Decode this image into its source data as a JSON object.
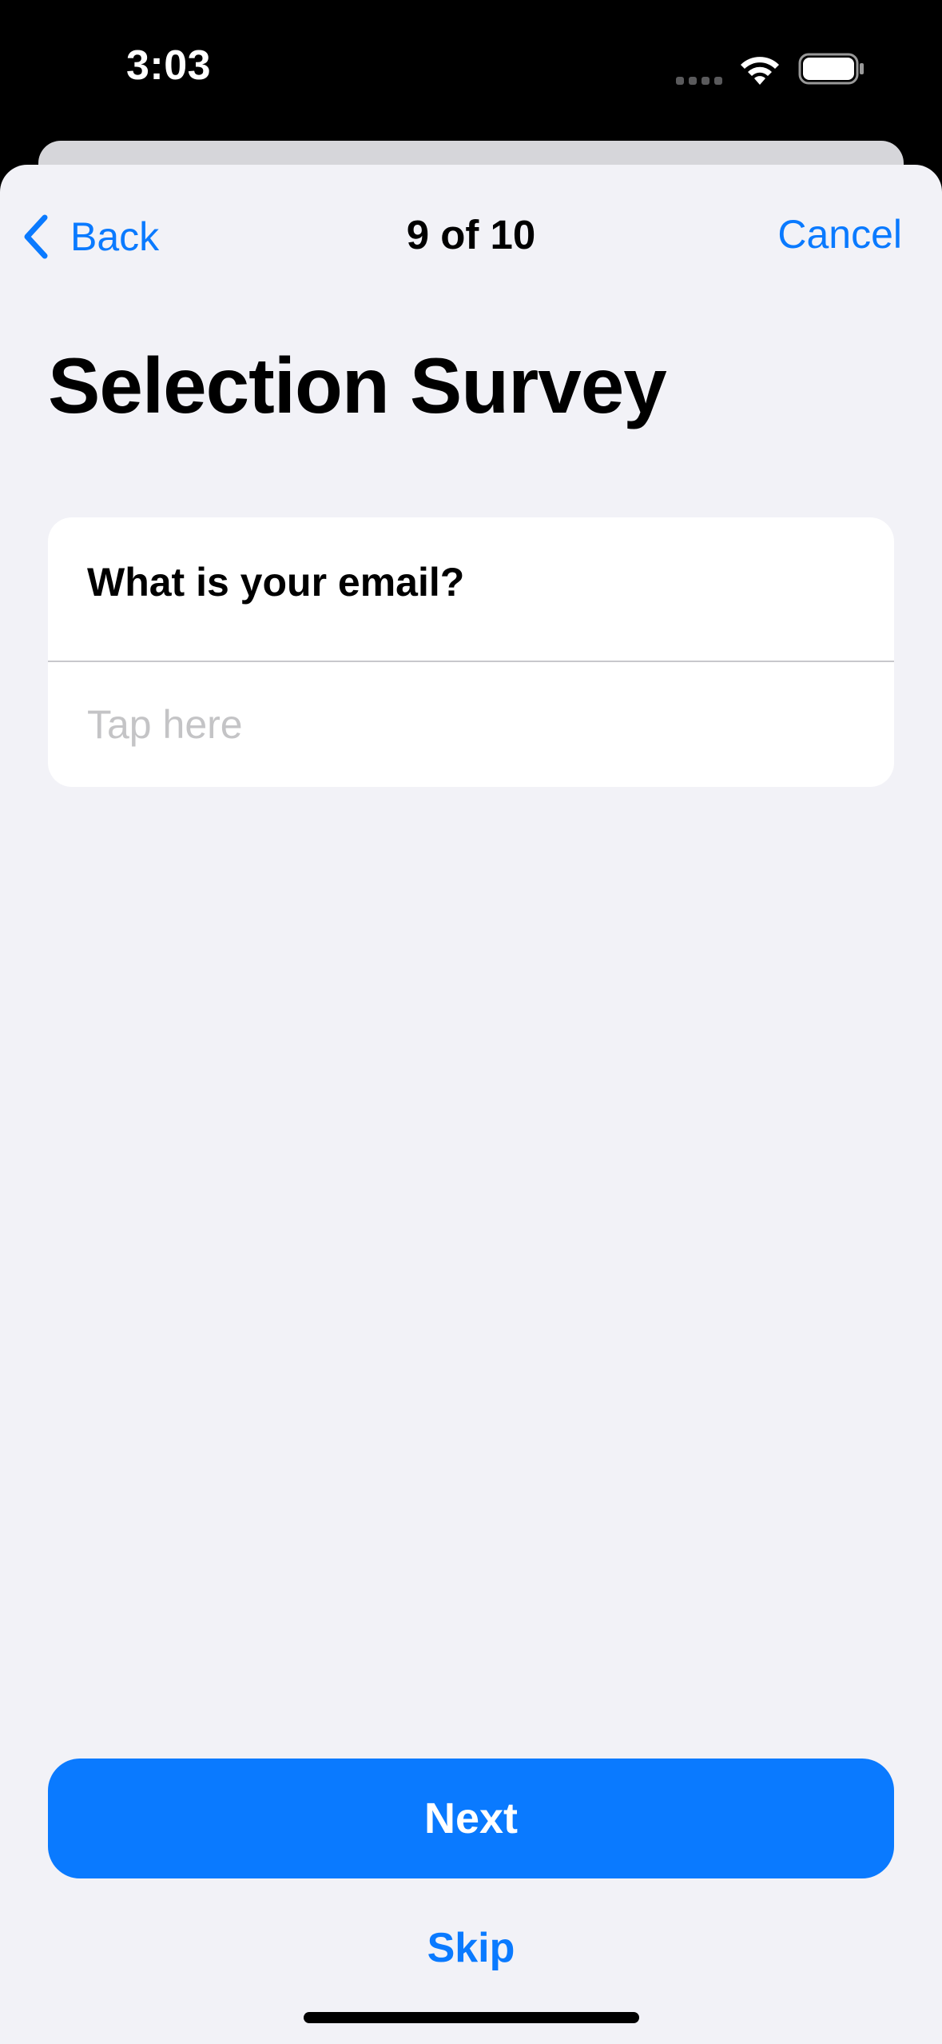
{
  "status_bar": {
    "time": "3:03",
    "icons": [
      "cellular-dots-icon",
      "wifi-icon",
      "battery-icon"
    ]
  },
  "nav": {
    "back_label": "Back",
    "back_icon": "chevron-left-icon",
    "title": "9 of 10",
    "cancel_label": "Cancel"
  },
  "page": {
    "title": "Selection Survey"
  },
  "question": {
    "text": "What is your email?",
    "placeholder": "Tap here",
    "value": ""
  },
  "actions": {
    "next_label": "Next",
    "skip_label": "Skip"
  },
  "colors": {
    "accent": "#0a7aff",
    "background": "#f2f2f7",
    "card": "#ffffff",
    "placeholder": "#c4c4c6"
  }
}
